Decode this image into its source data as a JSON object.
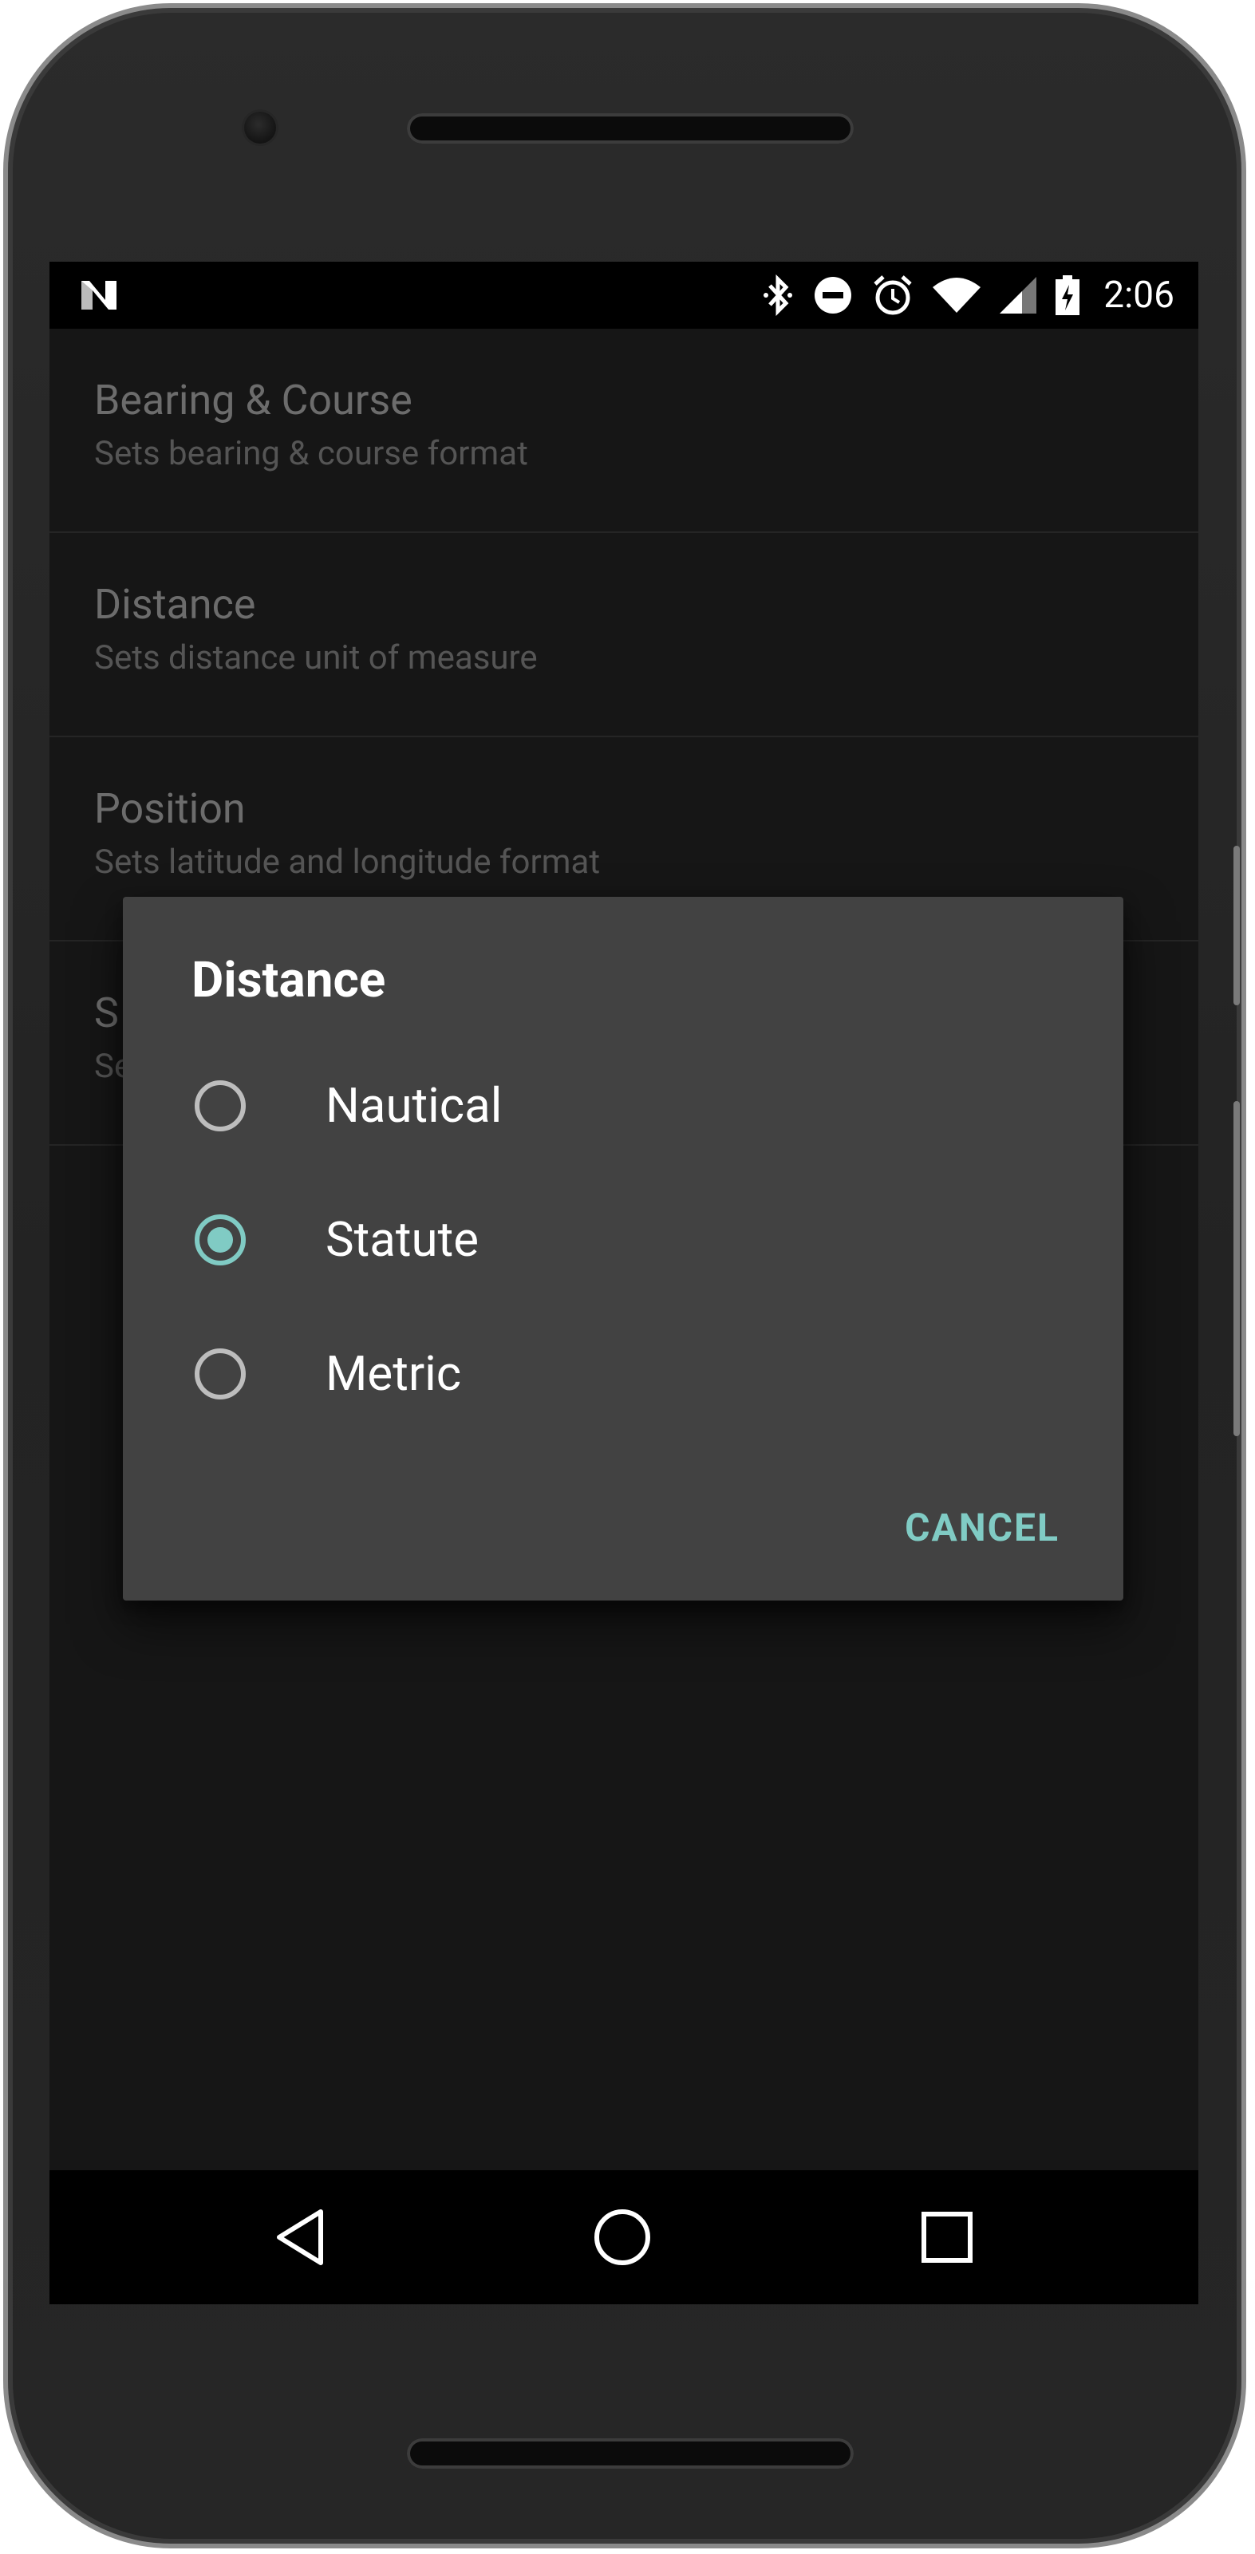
{
  "status_bar": {
    "time": "2:06",
    "left_icon": "n-notification-icon",
    "icons": [
      "bluetooth-icon",
      "do-not-disturb-icon",
      "alarm-icon",
      "wifi-icon",
      "cellular-signal-icon",
      "battery-charging-icon"
    ]
  },
  "settings": {
    "items": [
      {
        "title": "Bearing & Course",
        "summary": "Sets bearing & course format"
      },
      {
        "title": "Distance",
        "summary": "Sets distance unit of measure"
      },
      {
        "title": "Position",
        "summary": "Sets latitude and longitude format"
      },
      {
        "title": "S",
        "summary": "Se"
      }
    ]
  },
  "dialog": {
    "title": "Distance",
    "options": [
      {
        "label": "Nautical",
        "selected": false
      },
      {
        "label": "Statute",
        "selected": true
      },
      {
        "label": "Metric",
        "selected": false
      }
    ],
    "cancel_label": "CANCEL",
    "accent_color": "#80cbc4"
  },
  "nav_bar": {
    "icons": [
      "back-icon",
      "home-icon",
      "recents-icon"
    ]
  }
}
